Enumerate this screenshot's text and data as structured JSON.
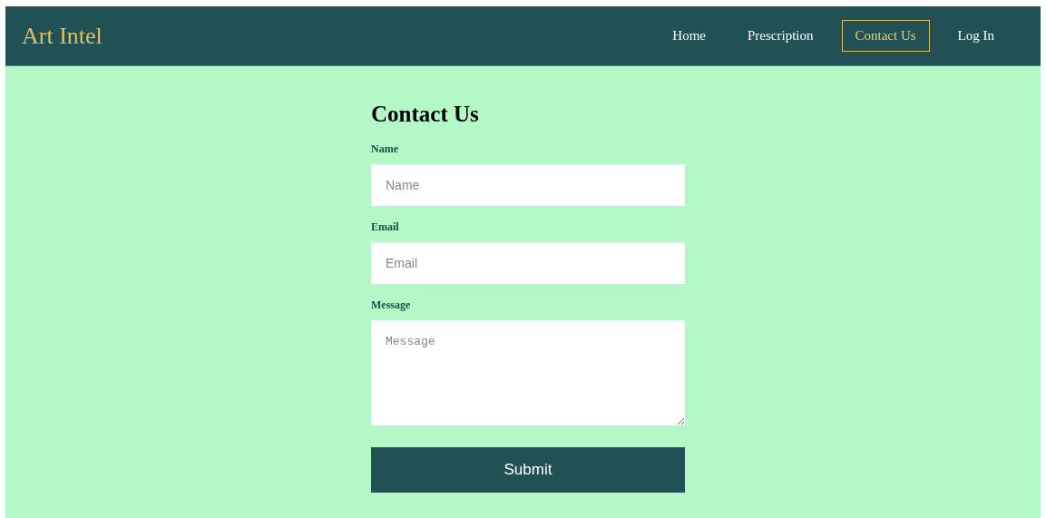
{
  "brand": "Art Intel",
  "nav": [
    {
      "label": "Home",
      "selected": false
    },
    {
      "label": "Prescription",
      "selected": false
    },
    {
      "label": "Contact Us",
      "selected": true
    },
    {
      "label": "Log In",
      "selected": false
    }
  ],
  "form": {
    "title": "Contact Us",
    "fields": [
      {
        "kind": "input",
        "label": "Name",
        "placeholder": "Name"
      },
      {
        "kind": "input",
        "label": "Email",
        "placeholder": "Email"
      },
      {
        "kind": "textarea",
        "label": "Message",
        "placeholder": "Message"
      }
    ],
    "submit": "Submit"
  }
}
